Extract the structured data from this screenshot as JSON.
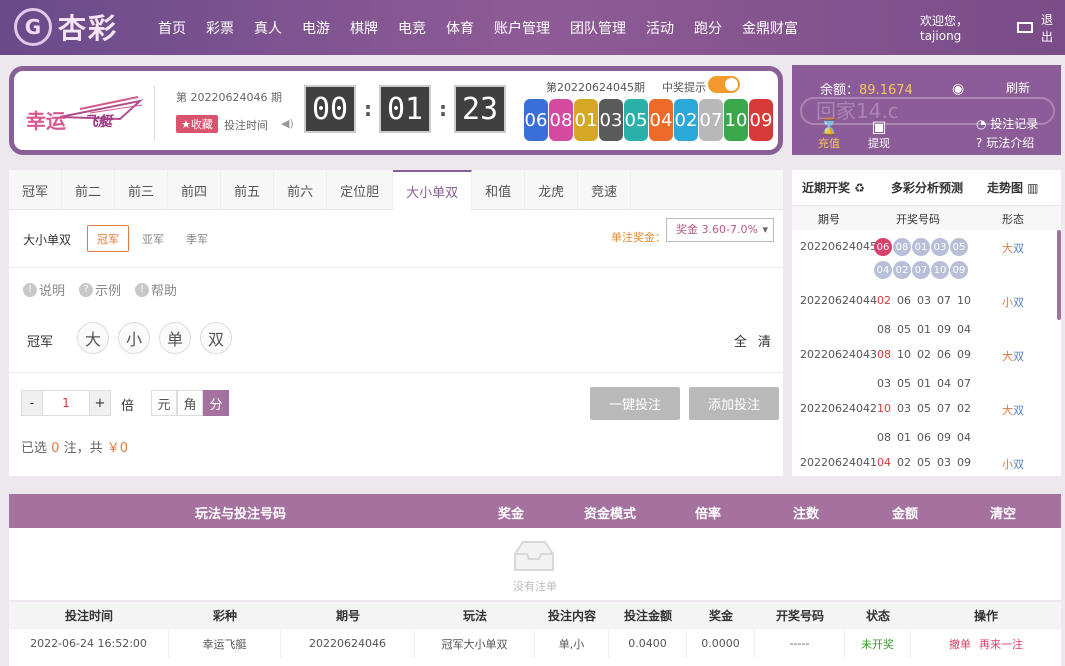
{
  "header": {
    "logo_mark": "G",
    "logo_text": "杏彩",
    "nav": [
      "首页",
      "彩票",
      "真人",
      "电游",
      "棋牌",
      "电竞",
      "体育",
      "账户管理",
      "团队管理",
      "活动",
      "跑分",
      "金鼎财富"
    ],
    "welcome": "欢迎您，tajiong",
    "logout": "退出"
  },
  "lottery": {
    "logo_line1": "幸运",
    "logo_line2": "飞艇",
    "current_period": "第 20220624046 期",
    "favorite": "★收藏",
    "countdown_label": "投注时间",
    "countdown": [
      "00",
      "01",
      "23"
    ],
    "last_period": "第20220624045期",
    "prize_tip_label": "中奖提示",
    "last_result": [
      "06",
      "08",
      "01",
      "03",
      "05",
      "04",
      "02",
      "07",
      "10",
      "09"
    ],
    "ball_colors": [
      "#3a6fd8",
      "#d44aa0",
      "#d4a824",
      "#5a5a5a",
      "#2ab0a8",
      "#ee6a2a",
      "#2aa8d8",
      "#b8b8b8",
      "#3aa84a",
      "#d83a3a"
    ]
  },
  "account": {
    "balance_label": "余额：",
    "balance": "89.1674",
    "refresh": "刷新",
    "recharge": "充值",
    "withdraw": "提现",
    "bet_records": "投注记录",
    "play_intro": "玩法介绍",
    "watermark": "回家14.c"
  },
  "play": {
    "tabs": [
      "冠军",
      "前二",
      "前三",
      "前四",
      "前五",
      "前六",
      "定位胆",
      "大小单双",
      "和值",
      "龙虎",
      "竞速"
    ],
    "active_tab": "大小单双",
    "sub_title": "大小单双",
    "subtabs": [
      "冠军",
      "亚军",
      "季军"
    ],
    "bonus_label": "单注奖金：",
    "bonus_value": "奖金 3.60-7.0%",
    "helps": [
      "说明",
      "示例",
      "帮助"
    ],
    "position_label": "冠军",
    "options": [
      "大",
      "小",
      "单",
      "双"
    ],
    "quick": [
      "全",
      "清"
    ],
    "multiplier": "1",
    "multiplier_label": "倍",
    "units": [
      "元",
      "角",
      "分"
    ],
    "btn_quick": "一键投注",
    "btn_add": "添加投注",
    "summary_pre": "已选",
    "summary_count": "0",
    "summary_mid": "注，共",
    "summary_amount": "￥0"
  },
  "recent": {
    "head_1": "近期开奖 ♻",
    "head_2": "多彩分析预测",
    "head_3": "走势图 ▥",
    "col_period": "期号",
    "col_nums": "开奖号码",
    "col_form": "形态",
    "rows": [
      {
        "period": "20220624045",
        "nums": [
          "06",
          "08",
          "01",
          "03",
          "05",
          "04",
          "02",
          "07",
          "10",
          "09"
        ],
        "form_a": "大",
        "form_b": "双"
      },
      {
        "period": "20220624044",
        "nums": [
          "02",
          "06",
          "03",
          "07",
          "10",
          "08",
          "05",
          "01",
          "09",
          "04"
        ],
        "form_a": "小",
        "form_b": "双"
      },
      {
        "period": "20220624043",
        "nums": [
          "08",
          "10",
          "02",
          "06",
          "09",
          "03",
          "05",
          "01",
          "04",
          "07"
        ],
        "form_a": "大",
        "form_b": "双"
      },
      {
        "period": "20220624042",
        "nums": [
          "10",
          "03",
          "05",
          "07",
          "02",
          "08",
          "01",
          "06",
          "09",
          "04"
        ],
        "form_a": "大",
        "form_b": "双"
      },
      {
        "period": "20220624041",
        "nums": [
          "04",
          "02",
          "05",
          "03",
          "09"
        ],
        "form_a": "小",
        "form_b": "双"
      }
    ]
  },
  "cart": {
    "headers": [
      "玩法与投注号码",
      "奖金",
      "资金模式",
      "倍率",
      "注数",
      "金额",
      "清空"
    ],
    "empty": "没有注单"
  },
  "orders": {
    "headers": [
      "投注时间",
      "彩种",
      "期号",
      "玩法",
      "投注内容",
      "投注金额",
      "奖金",
      "开奖号码",
      "状态",
      "操作"
    ],
    "row": {
      "time": "2022-06-24 16:52:00",
      "lottery": "幸运飞艇",
      "period": "20220624046",
      "play": "冠军大小单双",
      "content": "单,小",
      "amount": "0.0400",
      "bonus": "0.0000",
      "result": "-----",
      "status": "未开奖",
      "op1": "撤单",
      "op2": "再来一注"
    }
  }
}
